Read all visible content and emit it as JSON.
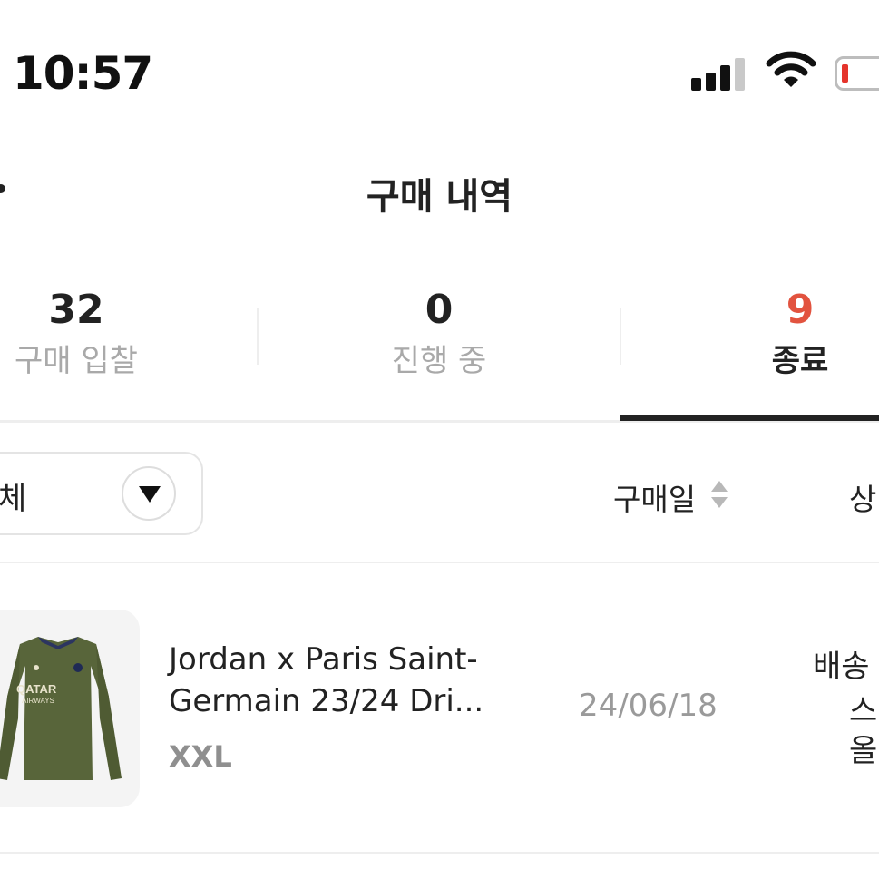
{
  "status_bar": {
    "time": "10:57",
    "icons": [
      "cellular-signal-icon",
      "wifi-icon",
      "battery-low-icon"
    ],
    "battery_color": "#e5342c"
  },
  "header": {
    "title": "구매 내역"
  },
  "tabs": [
    {
      "count": "32",
      "label": "구매 입찰"
    },
    {
      "count": "0",
      "label": "진행 중"
    },
    {
      "count": "9",
      "label": "종료",
      "active": true
    }
  ],
  "accent_color": "#e2533f",
  "filter": {
    "selected": "체"
  },
  "sort": {
    "label": "구매일"
  },
  "columns": {
    "status": "상"
  },
  "items": [
    {
      "name_line1": "Jordan x Paris Saint-",
      "name_line2": "Germain 23/24 Dri...",
      "size": "XXL",
      "date": "24/06/18",
      "status": "배송",
      "status_line2": "스",
      "status_line3": "올",
      "jersey_text": "QATAR",
      "jersey_subtext": "AIRWAYS"
    }
  ]
}
